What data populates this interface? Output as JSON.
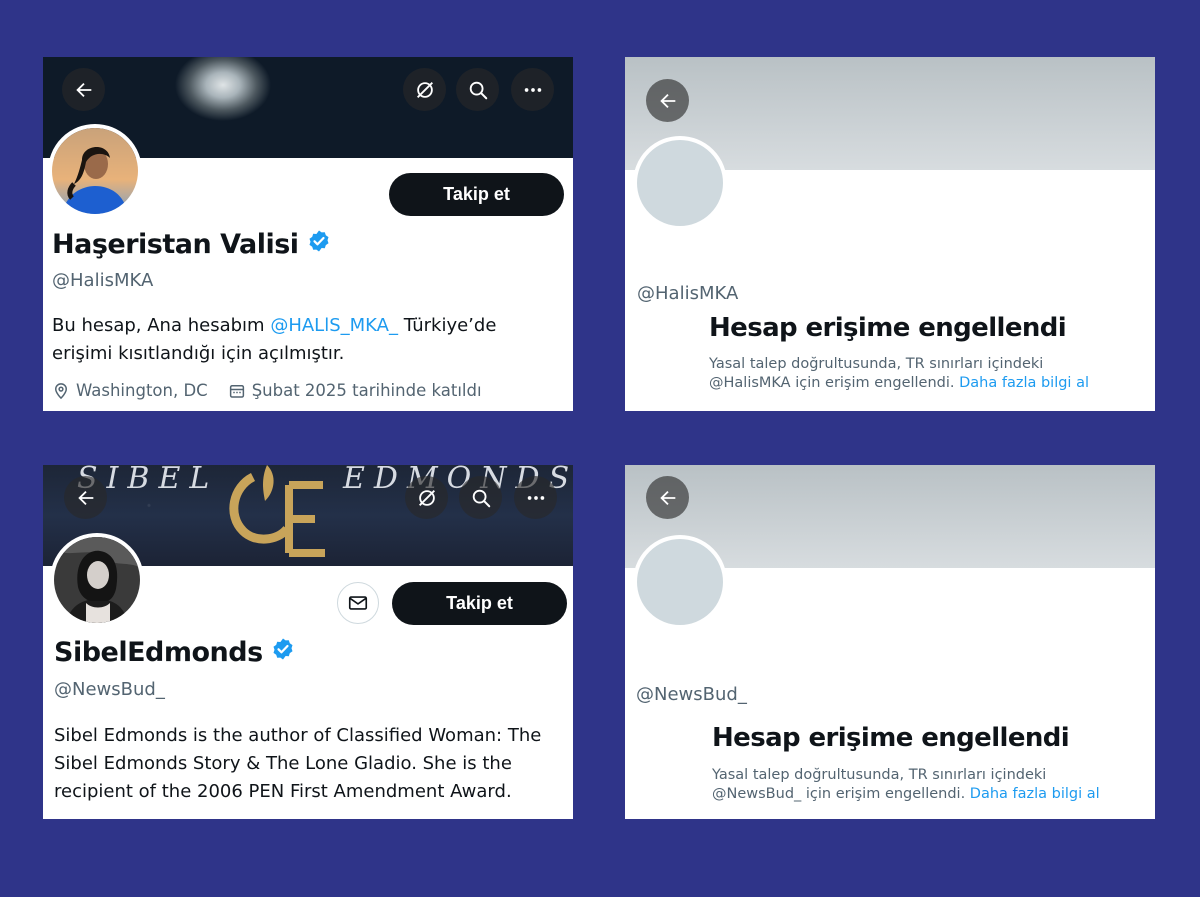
{
  "panels": {
    "p1": {
      "follow_label": "Takip et",
      "display_name": "Haşeristan Valisi",
      "handle": "@HalisMKA",
      "bio_before": "Bu hesap, Ana hesabım",
      "bio_mention": "@HALlS_MKA_",
      "bio_after_line1": "Türkiye’de",
      "bio_line2": "erişimi kısıtlandığı için açılmıştır.",
      "location": "Washington, DC",
      "joined": "Şubat 2025 tarihinde katıldı"
    },
    "p2": {
      "handle": "@HalisMKA",
      "title": "Hesap erişime engellendi",
      "desc_line1": "Yasal talep doğrultusunda, TR sınırları içindeki",
      "desc_line2": "@HalisMKA için erişim engellendi.",
      "desc_link": "Daha fazla bilgi al"
    },
    "p3": {
      "banner_left": "SIBEL",
      "banner_right": "EDMONDS",
      "follow_label": "Takip et",
      "display_name": "SibelEdmonds",
      "handle": "@NewsBud_",
      "bio_line1": "Sibel Edmonds is the author of Classified Woman: The",
      "bio_line2": "Sibel Edmonds Story & The Lone Gladio. She is the",
      "bio_line3": "recipient of the 2006 PEN First Amendment Award."
    },
    "p4": {
      "handle": "@NewsBud_",
      "title": "Hesap erişime engellendi",
      "desc_line1": "Yasal talep doğrultusunda, TR sınırları içindeki",
      "desc_line2": "@NewsBud_ için erişim engellendi.",
      "desc_link": "Daha fazla bilgi al"
    }
  },
  "icons": {
    "back": "back-arrow-icon",
    "grok": "grok-icon",
    "search": "search-icon",
    "more": "more-icon",
    "verified": "verified-badge-icon",
    "location": "location-pin-icon",
    "calendar": "calendar-icon",
    "mail": "mail-icon"
  },
  "colors": {
    "page_background": "#2f3489",
    "follow_button": "#0f1419",
    "link": "#1d9bf0",
    "secondary_text": "#536471",
    "verified": "#1d9bf0"
  }
}
